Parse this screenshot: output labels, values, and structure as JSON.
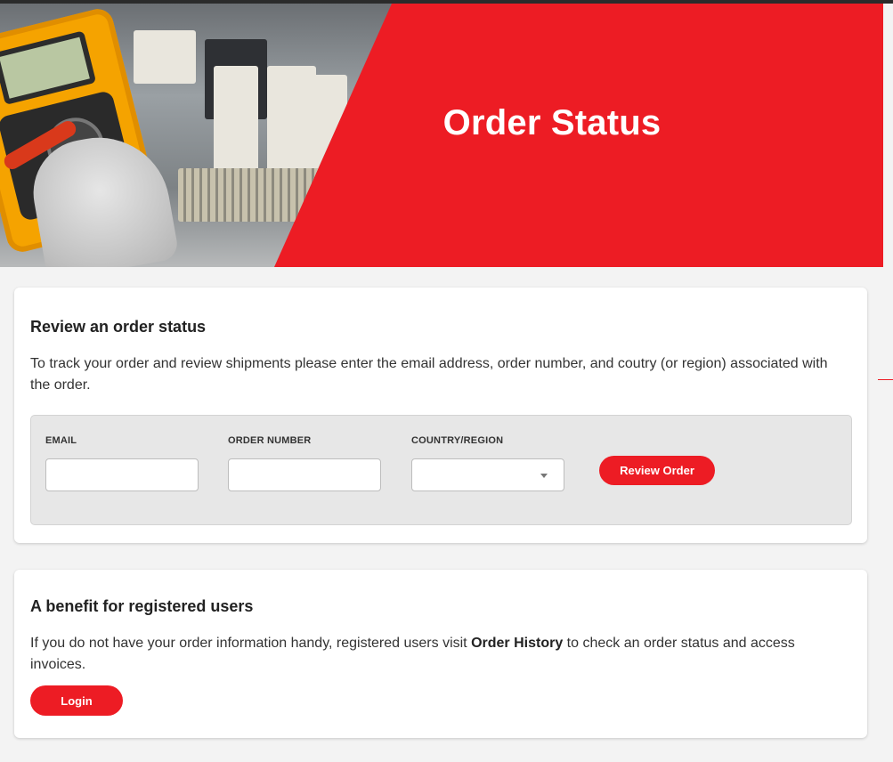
{
  "hero": {
    "title": "Order Status"
  },
  "review_card": {
    "heading": "Review an order status",
    "description": "To track your order and review shipments please enter the email address, order number, and coutry (or region) associated with the order.",
    "form": {
      "email_label": "EMAIL",
      "email_value": "",
      "order_number_label": "ORDER NUMBER",
      "order_number_value": "",
      "country_label": "COUNTRY/REGION",
      "country_value": "",
      "submit_label": "Review Order"
    }
  },
  "benefit_card": {
    "heading": "A benefit for registered users",
    "description_before": "If you do not have your order information handy, registered users visit ",
    "description_link": "Order History",
    "description_after": " to check an order status and access invoices.",
    "login_label": "Login"
  },
  "colors": {
    "brand_red": "#ed1c24",
    "page_bg": "#f3f3f3"
  }
}
